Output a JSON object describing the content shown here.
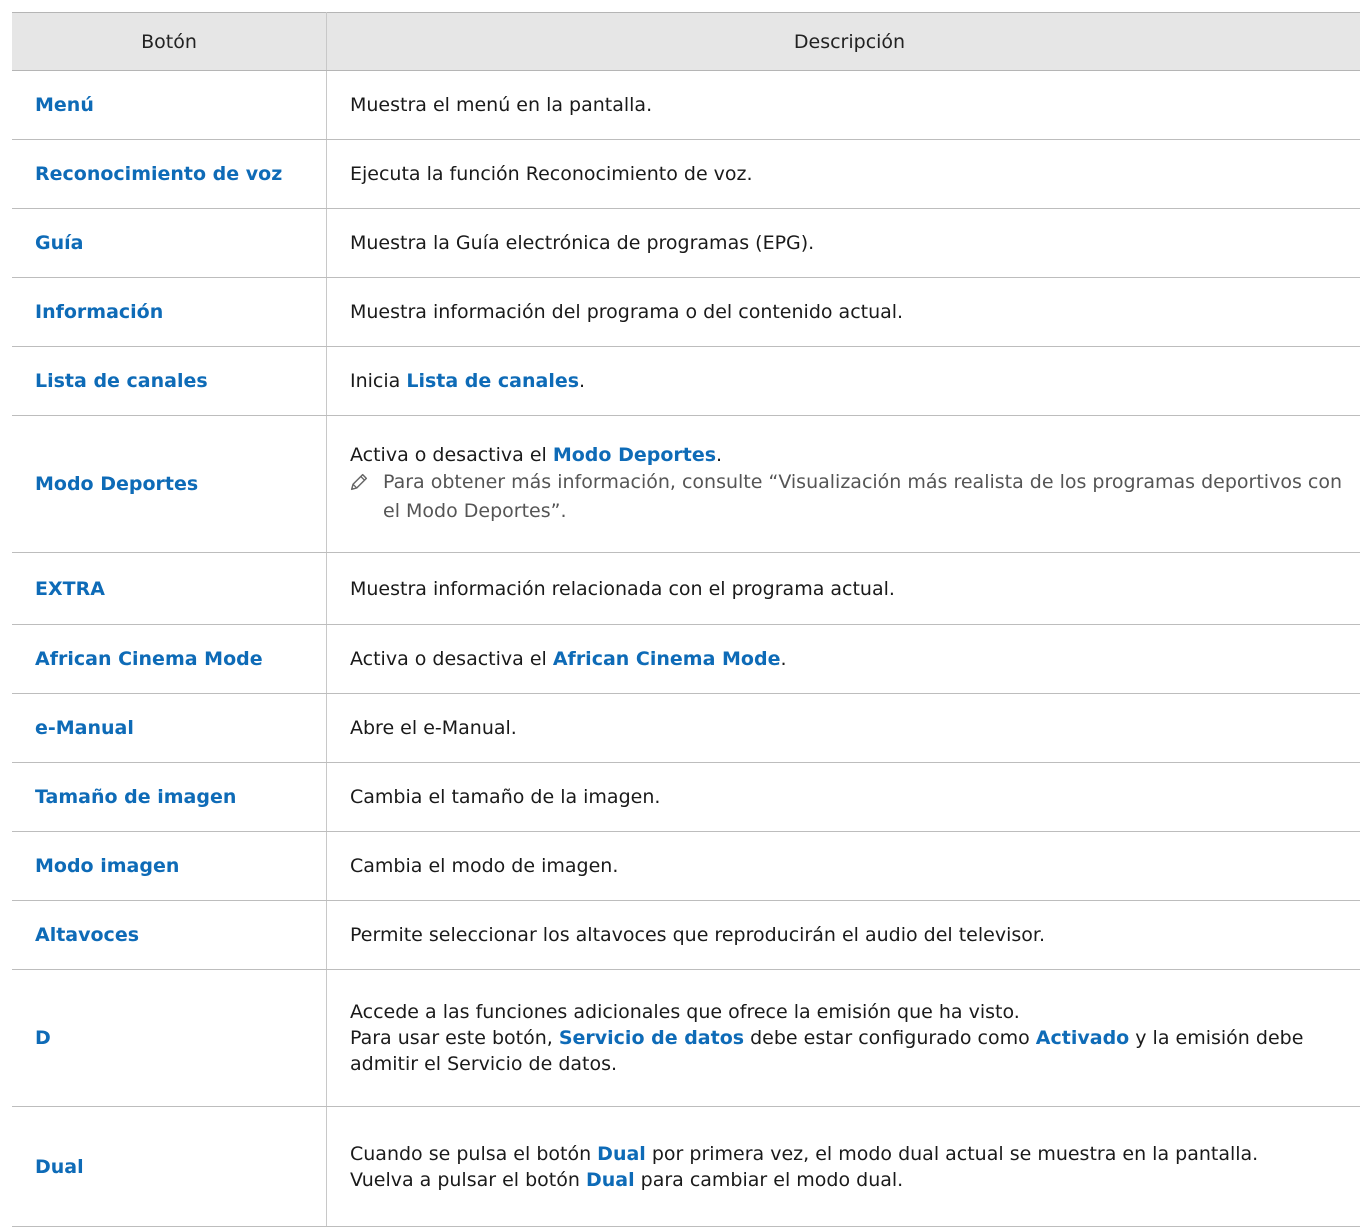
{
  "headers": {
    "button": "Botón",
    "description": "Descripción"
  },
  "rows": [
    {
      "button": "Menú",
      "description": "Muestra el menú en la pantalla."
    },
    {
      "button": "Reconocimiento de voz",
      "description": "Ejecuta la función Reconocimiento de voz."
    },
    {
      "button": "Guía",
      "description": "Muestra la Guía electrónica de programas (EPG)."
    },
    {
      "button": "Información",
      "description": "Muestra información del programa o del contenido actual."
    },
    {
      "button": "Lista de canales",
      "desc_pre": "Inicia ",
      "desc_kw": "Lista de canales",
      "desc_post": "."
    },
    {
      "button": "Modo Deportes",
      "desc_pre": "Activa o desactiva el ",
      "desc_kw": "Modo Deportes",
      "desc_post": ".",
      "note_icon": "pencil-icon",
      "note": "Para obtener más información, consulte “Visualización más realista de los programas deportivos con el Modo Deportes”."
    },
    {
      "button": "EXTRA",
      "description": "Muestra información relacionada con el programa actual."
    },
    {
      "button": "African Cinema Mode",
      "desc_pre": "Activa o desactiva el ",
      "desc_kw": "African Cinema Mode",
      "desc_post": "."
    },
    {
      "button": "e-Manual",
      "description": "Abre el e-Manual."
    },
    {
      "button": "Tamaño de imagen",
      "description": "Cambia el tamaño de la imagen."
    },
    {
      "button": "Modo imagen",
      "description": "Cambia el modo de imagen."
    },
    {
      "button": "Altavoces",
      "description": "Permite seleccionar los altavoces que reproducirán el audio del televisor."
    },
    {
      "button": "D",
      "line1": "Accede a las funciones adicionales que ofrece la emisión que ha visto.",
      "line2_pre": "Para usar este botón, ",
      "line2_kw1": "Servicio de datos",
      "line2_mid": " debe estar configurado como ",
      "line2_kw2": "Activado",
      "line2_post": " y la emisión debe admitir el Servicio de datos."
    },
    {
      "button": "Dual",
      "line1_pre": "Cuando se pulsa el botón ",
      "line1_kw": "Dual",
      "line1_post": " por primera vez, el modo dual actual se muestra en la pantalla.",
      "line2_pre": "Vuelva a pulsar el botón ",
      "line2_kw": "Dual",
      "line2_post": " para cambiar el modo dual."
    }
  ],
  "colors": {
    "link_blue": "#0e6bb7",
    "header_bg": "#e6e6e6",
    "border": "#bdbdbd"
  }
}
